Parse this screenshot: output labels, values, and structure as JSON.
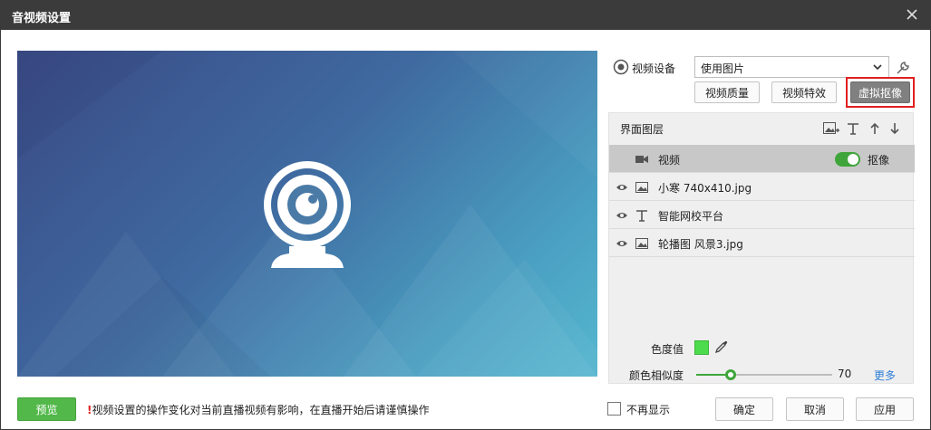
{
  "window": {
    "title": "音视频设置"
  },
  "device": {
    "label": "视频设备",
    "selected": "使用图片"
  },
  "buttons": {
    "quality": "视频质量",
    "effects": "视频特效",
    "virtual": "虚拟抠像"
  },
  "layers": {
    "title": "界面图层",
    "items": [
      {
        "name": "视频",
        "selected": true,
        "toggle_label": "抠像"
      },
      {
        "name": "小寒 740x410.jpg"
      },
      {
        "name": "智能网校平台"
      },
      {
        "name": "轮播图 风景3.jpg"
      }
    ]
  },
  "chroma": {
    "label": "色度值",
    "color": "#4cdb4c",
    "similarity_label": "颜色相似度",
    "similarity_value": "70",
    "similarity_fraction": 0.25,
    "more": "更多"
  },
  "footer": {
    "preview": "预览",
    "warning_mark": "!",
    "warning": "视频设置的操作变化对当前直播视频有影响，在直播开始后请谨慎操作",
    "dont_show": "不再显示",
    "ok": "确定",
    "cancel": "取消",
    "apply": "应用"
  },
  "colors": {
    "accent_green": "#52b84a",
    "highlight_red": "#e02020",
    "link": "#2f7fd6"
  }
}
